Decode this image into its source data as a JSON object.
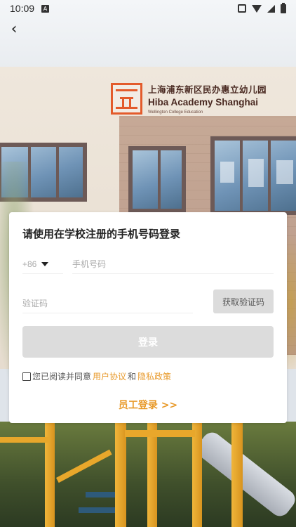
{
  "status_bar": {
    "time": "10:09",
    "icons": [
      "notification-a-icon",
      "vibrate-icon",
      "wifi-icon",
      "signal-icon",
      "battery-icon"
    ]
  },
  "nav": {
    "back_icon": "chevron-left-icon",
    "back_glyph": "‹"
  },
  "logo": {
    "name_cn": "上海浦东新区民办惠立幼儿园",
    "name_en": "Hiba Academy Shanghai",
    "subtitle": "Wellington College Education",
    "brand_color": "#e35b2b"
  },
  "login": {
    "title": "请使用在学校注册的手机号码登录",
    "country_code": "+86",
    "phone_placeholder": "手机号码",
    "code_placeholder": "验证码",
    "get_code_label": "获取验证码",
    "login_label": "登录",
    "agreement": {
      "prefix": "您已阅读并同意",
      "user_agreement": "用户协议",
      "and": "和",
      "privacy_policy": "隐私政策",
      "checked": false
    },
    "staff_login_label": "员工登录 >>",
    "accent_color": "#e89a2b",
    "disabled_button_color": "#dcdcdc"
  }
}
